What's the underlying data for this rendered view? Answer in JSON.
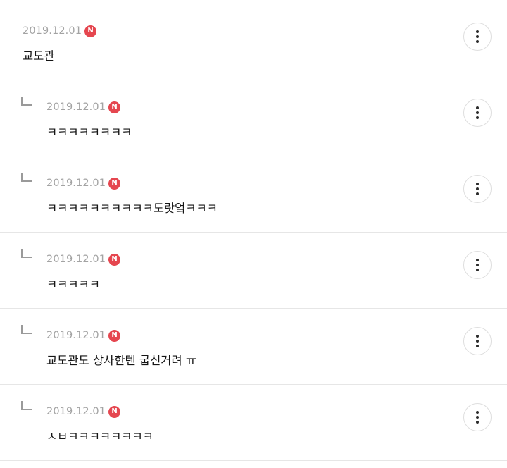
{
  "badge_label": "N",
  "colors": {
    "badge": "#e5464f",
    "date": "#a3a3a3",
    "text": "#141414",
    "divider": "#e6e6e6"
  },
  "icons": {
    "more": "more-vertical-icon",
    "reply": "reply-arrow-icon",
    "badge": "naver-n-icon"
  },
  "comments": [
    {
      "date": "2019.12.01",
      "text": "교도관",
      "is_reply": false
    },
    {
      "date": "2019.12.01",
      "text": "ㅋㅋㅋㅋㅋㅋㅋㅋ",
      "is_reply": true
    },
    {
      "date": "2019.12.01",
      "text": "ㅋㅋㅋㅋㅋㅋㅋㅋㅋㅋ도랏엌ㅋㅋㅋ",
      "is_reply": true
    },
    {
      "date": "2019.12.01",
      "text": "ㅋㅋㅋㅋㅋ",
      "is_reply": true
    },
    {
      "date": "2019.12.01",
      "text": "교도관도 상사한텐 굽신거려 ㅠ",
      "is_reply": true
    },
    {
      "date": "2019.12.01",
      "text": "ㅅㅂㅋㅋㅋㅋㅋㅋㅋㅋ",
      "is_reply": true
    }
  ]
}
